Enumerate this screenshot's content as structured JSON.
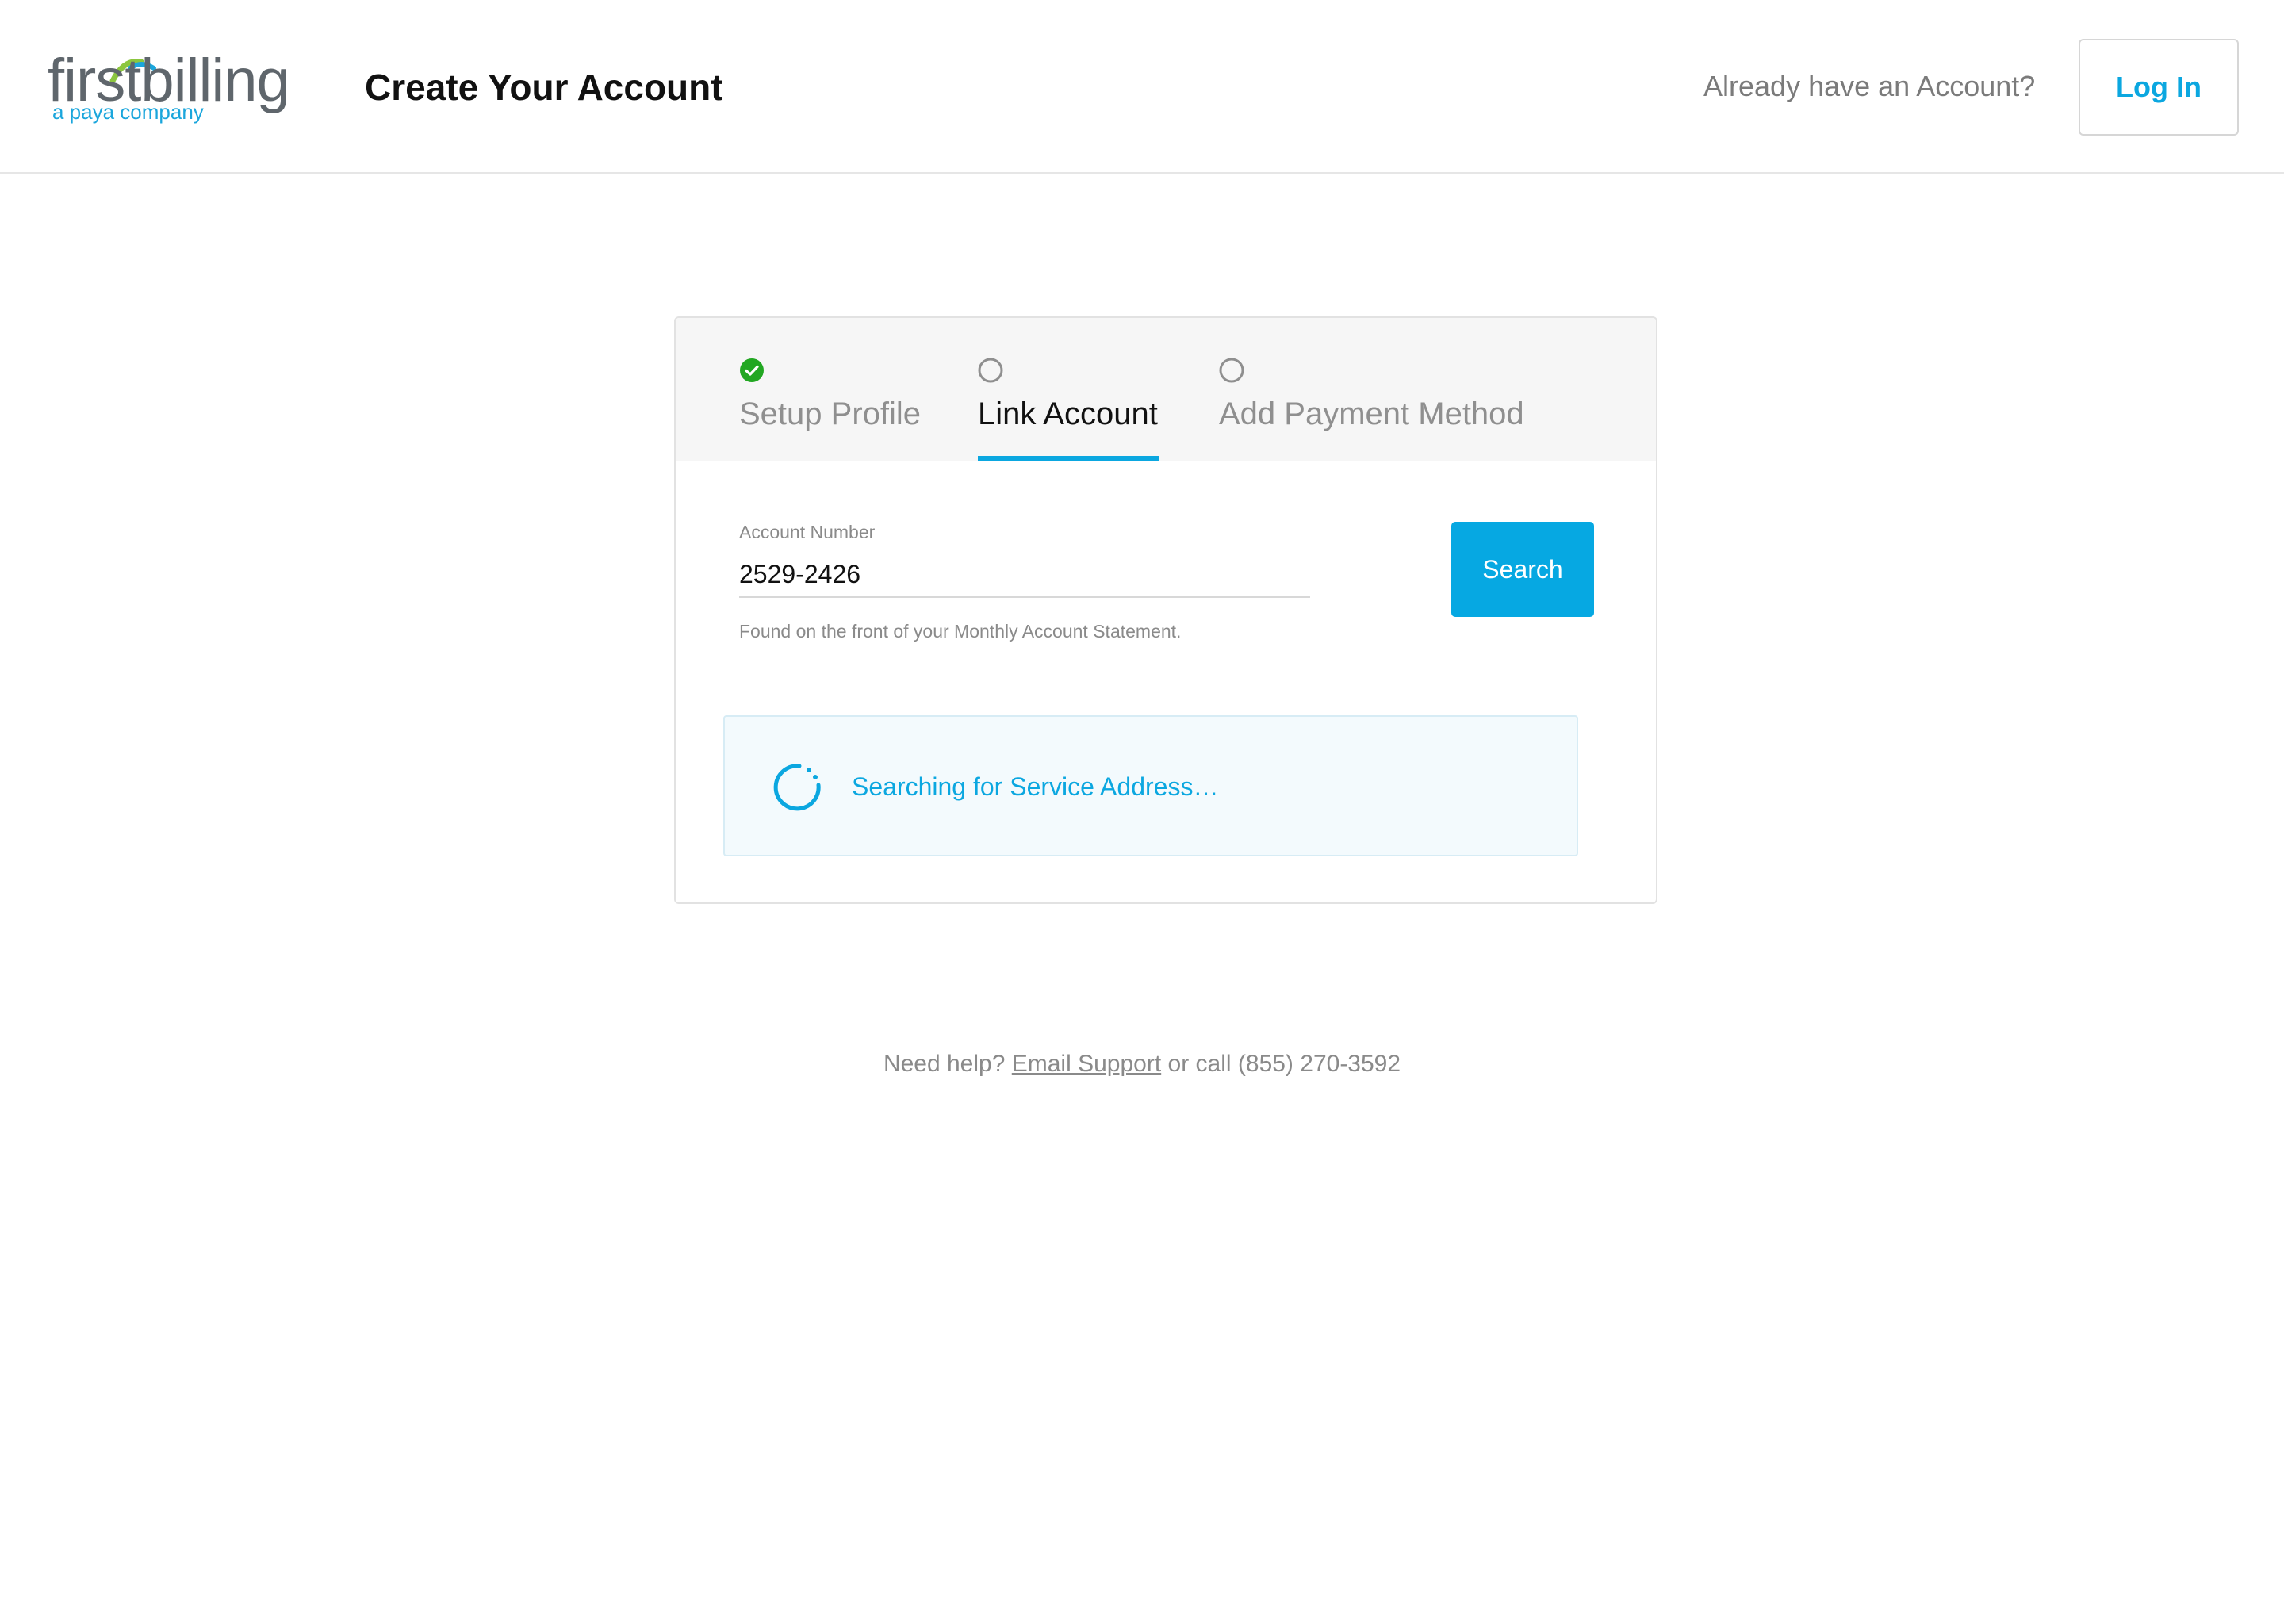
{
  "header": {
    "logo": {
      "wordmark": "firstbilling",
      "tagline": "a paya company",
      "colors": {
        "wordmark": "#5f666c",
        "tagline": "#1ba6dc",
        "arc_green": "#8cc63f",
        "arc_blue": "#1ba6dc"
      }
    },
    "title": "Create Your Account",
    "already_text": "Already have an Account?",
    "login_label": "Log In"
  },
  "stepper": {
    "steps": [
      {
        "label": "Setup Profile",
        "state": "complete",
        "icon": "check-circle-icon"
      },
      {
        "label": "Link Account",
        "state": "active",
        "icon": "empty-circle-icon"
      },
      {
        "label": "Add Payment Method",
        "state": "pending",
        "icon": "empty-circle-icon"
      }
    ]
  },
  "form": {
    "account_number_label": "Account Number",
    "account_number_value": "2529-2426",
    "hint": "Found on the front of your Monthly Account Statement.",
    "search_label": "Search"
  },
  "status": {
    "icon": "loading-spinner-icon",
    "message": "Searching for Service Address…"
  },
  "help": {
    "prefix": "Need help?",
    "link_label": "Email Support",
    "suffix": "or call (855) 270-3592"
  },
  "colors": {
    "accent": "#0ba7e0",
    "success": "#22a722",
    "text_primary": "#111111",
    "text_muted": "#8a8a8a"
  }
}
